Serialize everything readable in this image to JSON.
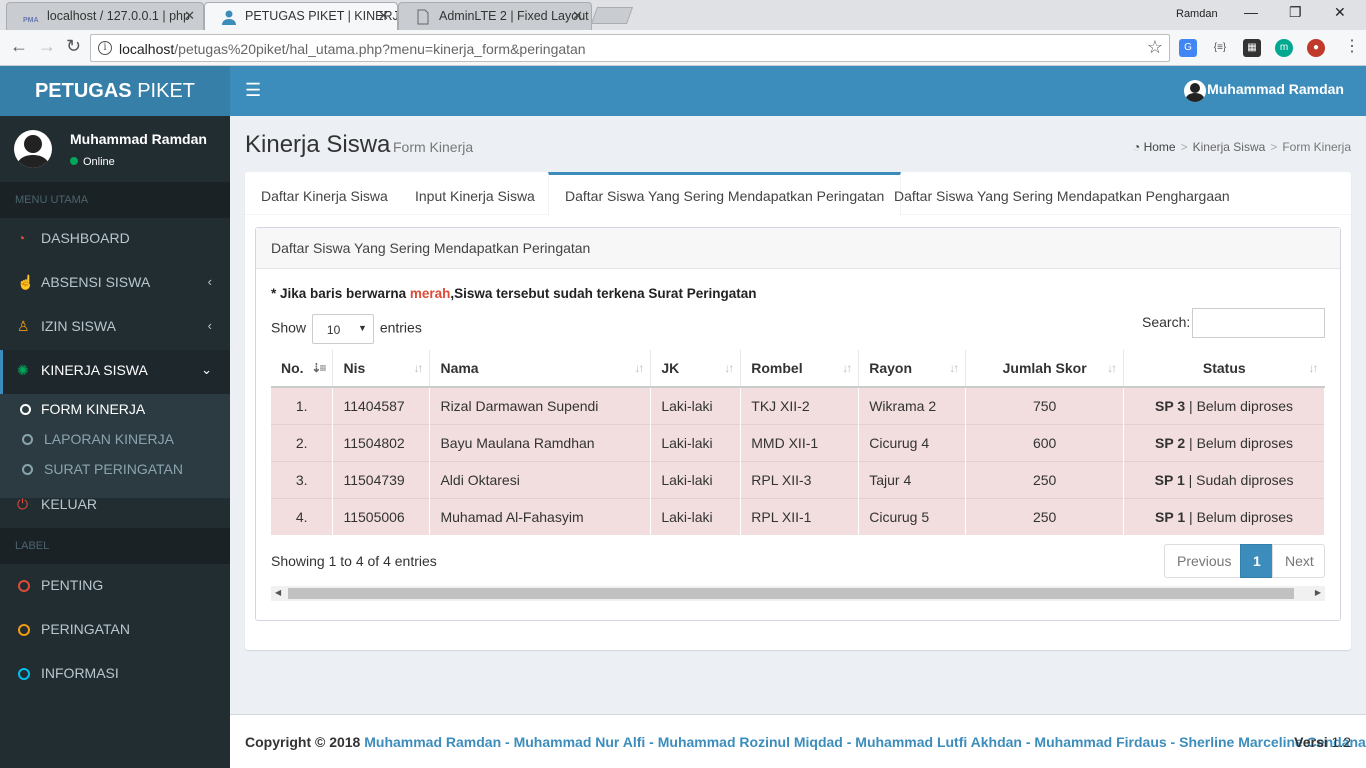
{
  "browser": {
    "tabs": [
      {
        "title": "localhost / 127.0.0.1 | php",
        "active": false
      },
      {
        "title": "PETUGAS PIKET | KINERJA",
        "active": true
      },
      {
        "title": "AdminLTE 2 | Fixed Layout",
        "active": false
      }
    ],
    "profile_name": "Ramdan",
    "url_host": "localhost",
    "url_path": "/petugas%20piket/hal_utama.php?menu=kinerja_form&peringatan",
    "pma_label": "PMA"
  },
  "header": {
    "logo_bold": "PETUGAS",
    "logo_rest": " PIKET",
    "user_name": "Muhammad Ramdan"
  },
  "sidebar": {
    "user_name": "Muhammad Ramdan",
    "status": "Online",
    "menu_header": "MENU UTAMA",
    "items": [
      {
        "label": "DASHBOARD"
      },
      {
        "label": "ABSENSI SISWA"
      },
      {
        "label": "IZIN SISWA"
      },
      {
        "label": "KINERJA SISWA"
      }
    ],
    "sub_items": [
      {
        "label": "FORM KINERJA"
      },
      {
        "label": "LAPORAN KINERJA"
      },
      {
        "label": "SURAT PERINGATAN"
      }
    ],
    "logout": "KELUAR",
    "label_header": "LABEL",
    "labels": [
      {
        "label": "PENTING",
        "color": "#dd4b39"
      },
      {
        "label": "PERINGATAN",
        "color": "#f39c12"
      },
      {
        "label": "INFORMASI",
        "color": "#00c0ef"
      }
    ]
  },
  "page": {
    "title": "Kinerja Siswa",
    "subtitle": "Form Kinerja",
    "breadcrumb": {
      "home": "Home",
      "section": "Kinerja Siswa",
      "current": "Form Kinerja"
    }
  },
  "tabs": [
    {
      "label": "Daftar Kinerja Siswa"
    },
    {
      "label": "Input Kinerja Siswa"
    },
    {
      "label": "Daftar Siswa Yang Sering Mendapatkan Peringatan"
    },
    {
      "label": "Daftar Siswa Yang Sering Mendapatkan Penghargaan"
    }
  ],
  "box": {
    "title": "Daftar Siswa Yang Sering Mendapatkan Peringatan",
    "note_prefix": "* Jika baris berwarna ",
    "note_red": "merah",
    "note_suffix": ",Siswa tersebut sudah terkena Surat Peringatan",
    "show_label": "Show",
    "show_value": "10",
    "entries_label": "entries",
    "search_label": "Search:",
    "search_value": ""
  },
  "table": {
    "columns": [
      "No.",
      "Nis",
      "Nama",
      "JK",
      "Rombel",
      "Rayon",
      "Jumlah Skor",
      "Status"
    ],
    "rows": [
      {
        "no": "1.",
        "nis": "11404587",
        "nama": "Rizal Darmawan Supendi",
        "jk": "Laki-laki",
        "rombel": "TKJ XII-2",
        "rayon": "Wikrama 2",
        "skor": "750",
        "sp": "SP 3",
        "status": "Belum diproses"
      },
      {
        "no": "2.",
        "nis": "11504802",
        "nama": "Bayu Maulana Ramdhan",
        "jk": "Laki-laki",
        "rombel": "MMD XII-1",
        "rayon": "Cicurug 4",
        "skor": "600",
        "sp": "SP 2",
        "status": "Belum diproses"
      },
      {
        "no": "3.",
        "nis": "11504739",
        "nama": "Aldi Oktaresi",
        "jk": "Laki-laki",
        "rombel": "RPL XII-3",
        "rayon": "Tajur 4",
        "skor": "250",
        "sp": "SP 1",
        "status": "Sudah diproses"
      },
      {
        "no": "4.",
        "nis": "11505006",
        "nama": "Muhamad Al-Fahasyim",
        "jk": "Laki-laki",
        "rombel": "RPL XII-1",
        "rayon": "Cicurug 5",
        "skor": "250",
        "sp": "SP 1",
        "status": "Belum diproses"
      }
    ],
    "info": "Showing 1 to 4 of 4 entries",
    "pagination": {
      "previous": "Previous",
      "current": "1",
      "next": "Next"
    }
  },
  "footer": {
    "copyright": "Copyright © 2018",
    "names": "Muhammad Ramdan - Muhammad Nur Alfi - Muhammad Rozinul Miqdad - Muhammad Lutfi Akhdan - Muhammad Firdaus - Sherline Marceline Cendana",
    "version_label": "Versi",
    "version": "1.2"
  },
  "colors": {
    "primary": "#3c8dbc",
    "logo_bg": "#367fa9",
    "sidebar_bg": "#222d32",
    "warning_row": "#f2dede",
    "danger": "#dd4b39"
  }
}
